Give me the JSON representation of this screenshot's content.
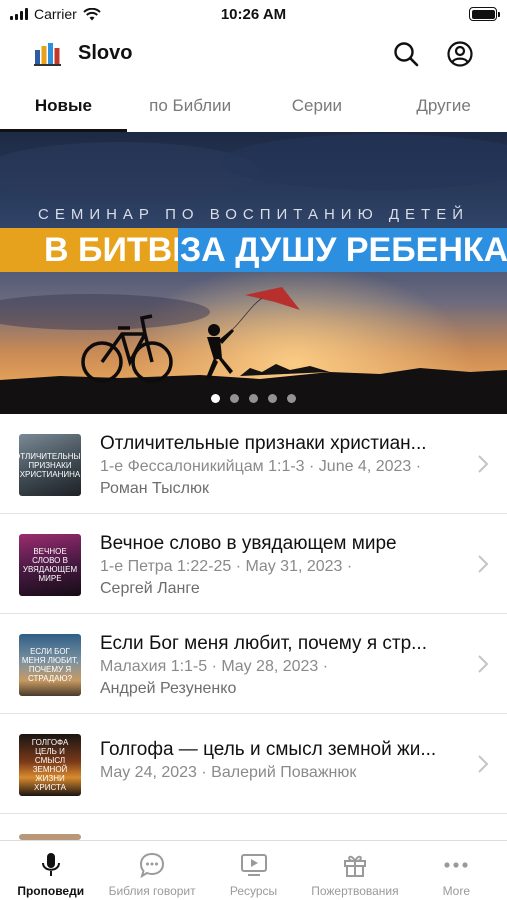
{
  "status_bar": {
    "carrier": "Carrier",
    "time": "10:26 AM"
  },
  "app": {
    "title": "Slovo",
    "icons": [
      "search-icon",
      "account-icon"
    ]
  },
  "tabs": [
    {
      "label": "Новые",
      "active": true
    },
    {
      "label": "по Библии",
      "active": false
    },
    {
      "label": "Серии",
      "active": false
    },
    {
      "label": "Другие",
      "active": false
    }
  ],
  "banner": {
    "subtitle": "СЕМИНАР ПО ВОСПИТАНИЮ ДЕТЕЙ",
    "title_part1": "В БИТВЕ",
    "title_part2": "ЗА ДУШУ РЕБЕНКА",
    "page_count": 5,
    "active_page": 1
  },
  "sermons": [
    {
      "title": "Отличительные признаки христиан...",
      "meta": "1-е Фессалоникийцам 1:1-3 · June 4, 2023 ·",
      "author": "Роман Тыслюк",
      "thumb_text": "Отличительные признаки христианина"
    },
    {
      "title": "Вечное слово в увядающем мире",
      "meta": "1-е Петра 1:22-25 · May 31, 2023 ·",
      "author": "Сергей Ланге",
      "thumb_text": "Вечное слово в увядающем мире"
    },
    {
      "title": "Если Бог меня любит, почему я стр...",
      "meta": "Малахия 1:1-5 · May 28, 2023 ·",
      "author": "Андрей Резуненко",
      "thumb_text": "Если Бог меня любит, почему я страдаю?"
    },
    {
      "title": "Голгофа — цель и смысл земной жи...",
      "meta": "May 24, 2023 · Валерий Поважнюк",
      "author": "",
      "thumb_text": "Голгофа цель и смысл земной жизни Христа"
    }
  ],
  "tabbar": [
    {
      "label": "Проповеди",
      "icon": "microphone-icon",
      "active": true
    },
    {
      "label": "Библия говорит",
      "icon": "chat-bubble-icon",
      "active": false
    },
    {
      "label": "Ресурсы",
      "icon": "video-icon",
      "active": false
    },
    {
      "label": "Пожертвования",
      "icon": "gift-icon",
      "active": false
    },
    {
      "label": "More",
      "icon": "more-dots-icon",
      "active": false
    }
  ],
  "colors": {
    "banner_orange": "#e6a11d",
    "banner_blue": "#2c8fe0",
    "active_text": "#111111",
    "inactive_text": "#9a9a9a"
  }
}
